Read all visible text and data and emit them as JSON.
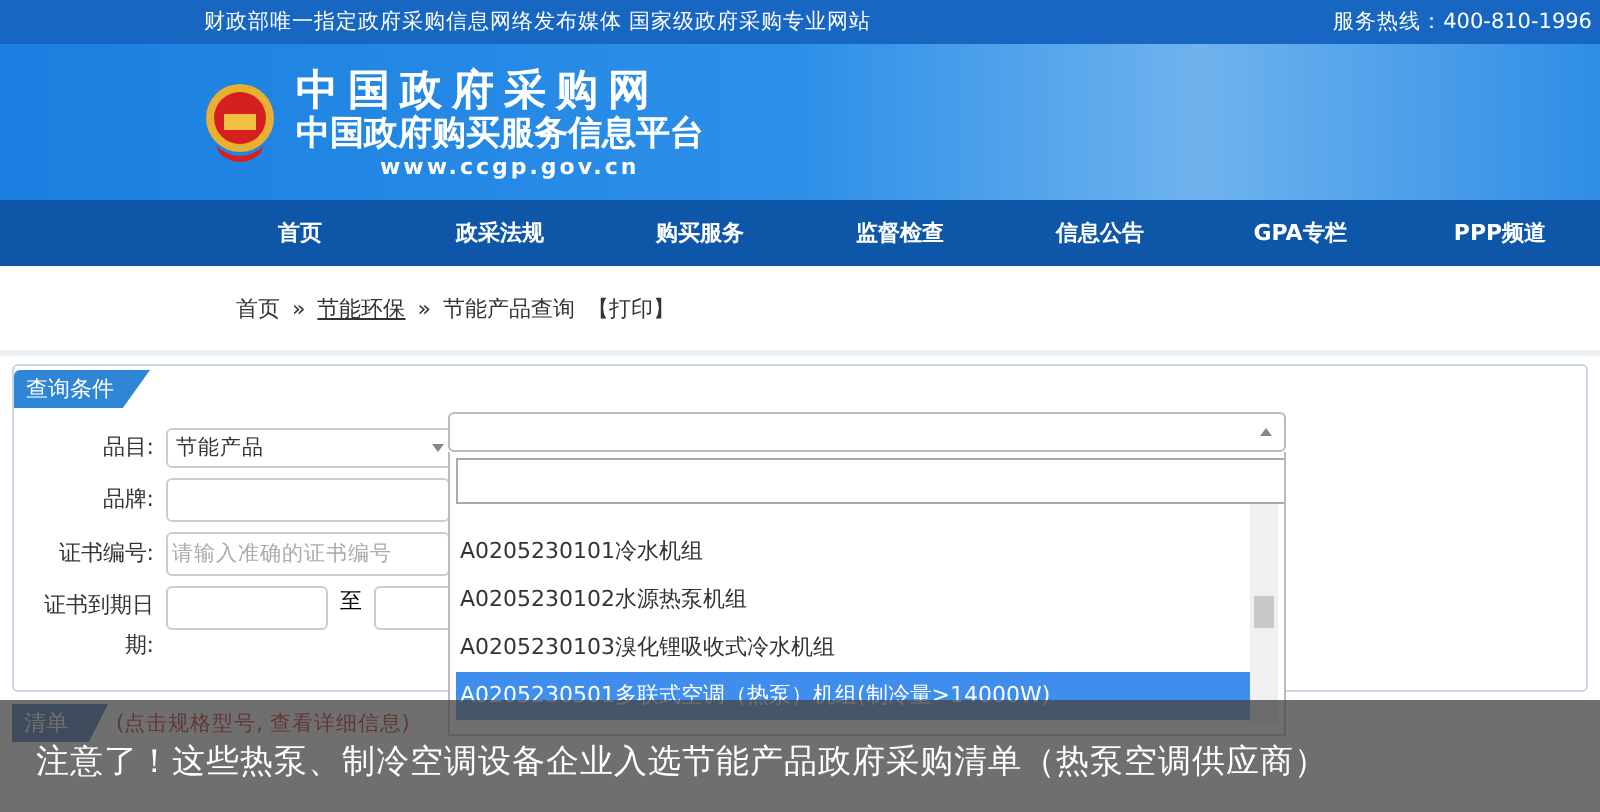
{
  "top_bar": {
    "slogan": "财政部唯一指定政府采购信息网络发布媒体  国家级政府采购专业网站",
    "hotline": "服务热线：400-810-1996"
  },
  "logo": {
    "title": "中国政府采购网",
    "subtitle": "中国政府购买服务信息平台",
    "url": "www.ccgp.gov.cn"
  },
  "nav": [
    {
      "label": "首页",
      "selected": false
    },
    {
      "label": "政采法规",
      "selected": false
    },
    {
      "label": "购买服务",
      "selected": false
    },
    {
      "label": "监督检查",
      "selected": false
    },
    {
      "label": "信息公告",
      "selected": false
    },
    {
      "label": "GPA专栏",
      "selected": false
    },
    {
      "label": "PPP频道",
      "selected": false
    }
  ],
  "breadcrumb": [
    {
      "label": "首页",
      "kind": "plain"
    },
    {
      "label": "节能环保",
      "kind": "link"
    },
    {
      "label": "节能产品查询",
      "kind": "plain"
    }
  ],
  "breadcrumb_separator": "»",
  "print_link": "【打印】",
  "query": {
    "title": "查询条件",
    "fields": [
      {
        "label": "品目:",
        "kind": "select",
        "value": "节能产品"
      },
      {
        "label": "品牌:",
        "kind": "text"
      },
      {
        "label": "证书编号:",
        "kind": "text",
        "placeholder": "请输入准确的证书编号"
      },
      {
        "label": "证书到期日期:",
        "kind": "range",
        "separator": "至"
      }
    ]
  },
  "dropdown": {
    "items": [
      {
        "label": "A0205230101冷水机组",
        "selected": false
      },
      {
        "label": "A0205230102水源热泵机组",
        "selected": false
      },
      {
        "label": "A0205230103溴化锂吸收式冷水机组",
        "selected": false
      },
      {
        "label": "A0205230501多联式空调（热泵）机组(制冷量>14000W)",
        "selected": true
      }
    ]
  },
  "list_header": {
    "title": "清单",
    "hint": "(点击规格型号, 查看详细信息)"
  },
  "caption": "注意了！这些热泵、制冷空调设备企业入选节能产品政府采购清单（热泵空调供应商）"
}
